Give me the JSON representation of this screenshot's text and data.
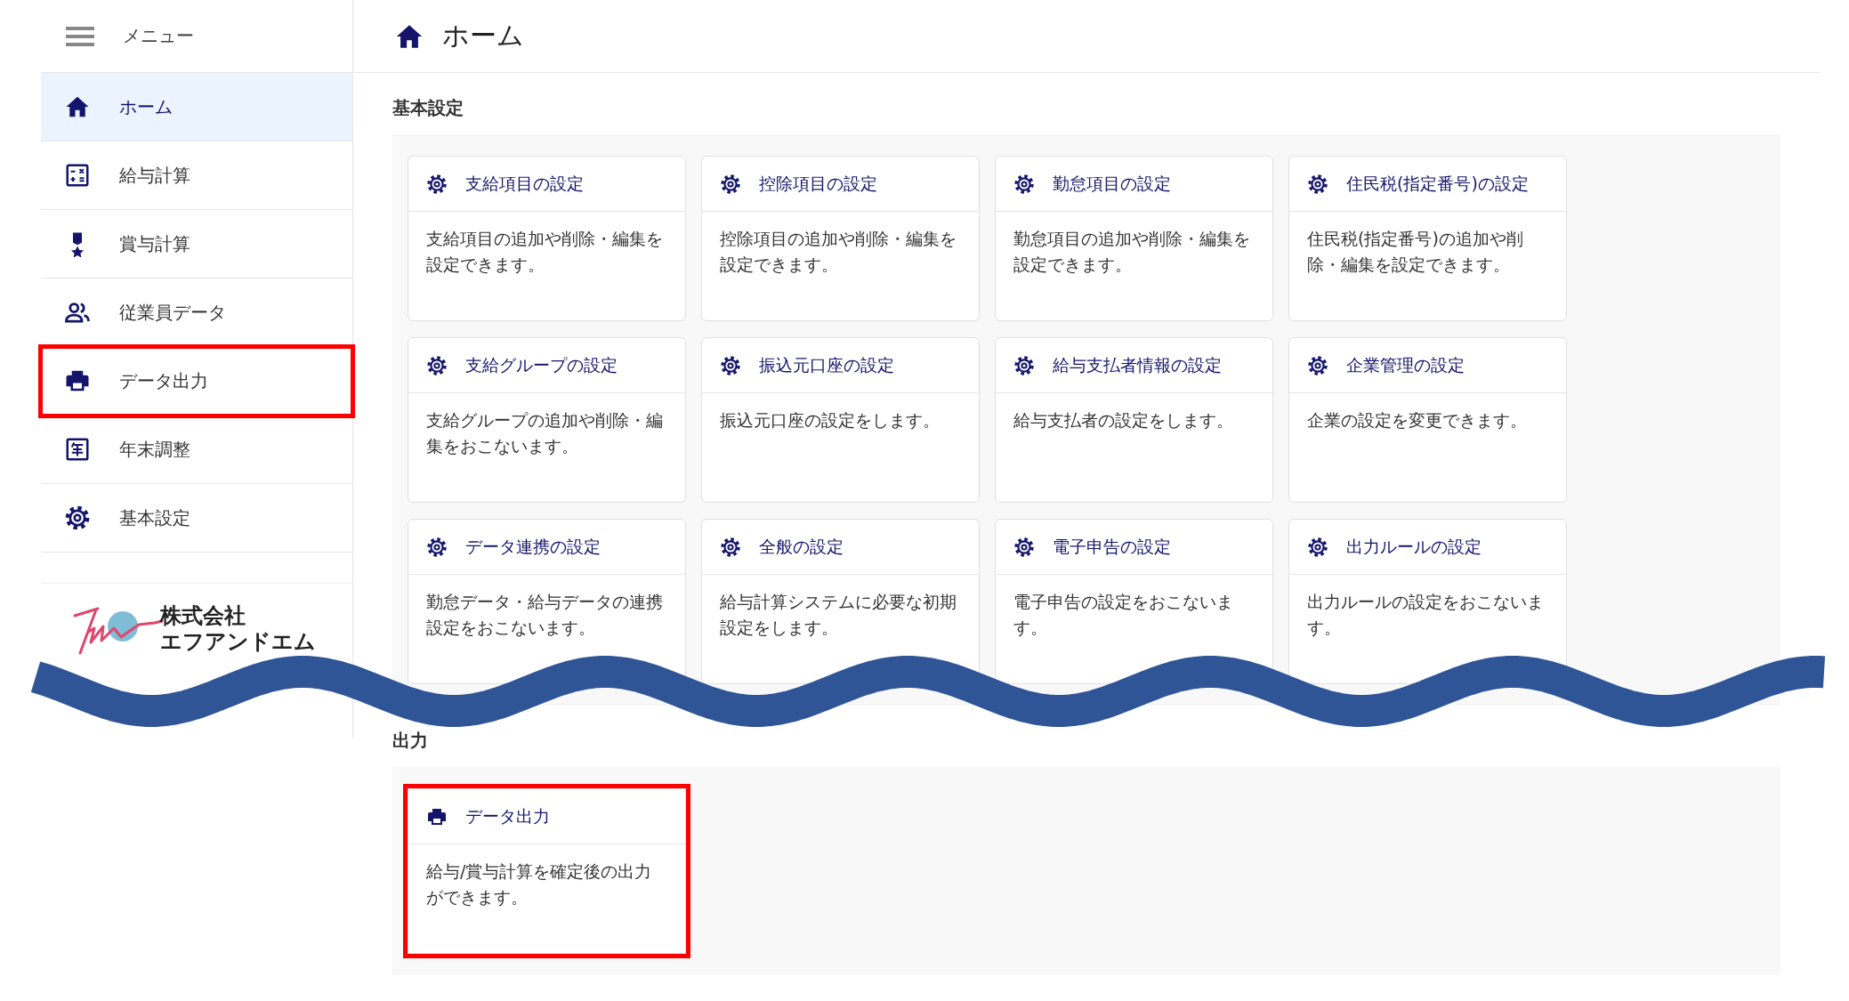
{
  "sidebar": {
    "menu_label": "メニュー",
    "items": [
      {
        "label": "ホーム",
        "kind": "home",
        "selected": true,
        "annotated": false
      },
      {
        "label": "給与計算",
        "kind": "salary",
        "selected": false,
        "annotated": false
      },
      {
        "label": "賞与計算",
        "kind": "bonus",
        "selected": false,
        "annotated": false
      },
      {
        "label": "従業員データ",
        "kind": "employees",
        "selected": false,
        "annotated": false
      },
      {
        "label": "データ出力",
        "kind": "export",
        "selected": false,
        "annotated": true
      },
      {
        "label": "年末調整",
        "kind": "year-end",
        "selected": false,
        "annotated": false
      },
      {
        "label": "基本設定",
        "kind": "settings",
        "selected": false,
        "annotated": false
      }
    ],
    "logo": {
      "line_1": "株式会社",
      "line_2": "エフアンドエム"
    }
  },
  "header": {
    "title": "ホーム"
  },
  "sections": [
    {
      "title": "基本設定",
      "cards": [
        {
          "kind": "settings",
          "title": "支給項目の設定",
          "description": "支給項目の追加や削除・編集を設定できます。",
          "annotated": false
        },
        {
          "kind": "settings",
          "title": "控除項目の設定",
          "description": "控除項目の追加や削除・編集を設定できます。",
          "annotated": false
        },
        {
          "kind": "settings",
          "title": "勤怠項目の設定",
          "description": "勤怠項目の追加や削除・編集を設定できます。",
          "annotated": false
        },
        {
          "kind": "settings",
          "title": "住民税(指定番号)の設定",
          "description": "住民税(指定番号)の追加や削除・編集を設定できます。",
          "annotated": false
        },
        {
          "kind": "settings",
          "title": "支給グループの設定",
          "description": "支給グループの追加や削除・編集をおこないます。",
          "annotated": false
        },
        {
          "kind": "settings",
          "title": "振込元口座の設定",
          "description": "振込元口座の設定をします。",
          "annotated": false
        },
        {
          "kind": "settings",
          "title": "給与支払者情報の設定",
          "description": "給与支払者の設定をします。",
          "annotated": false
        },
        {
          "kind": "settings",
          "title": "企業管理の設定",
          "description": "企業の設定を変更できます。",
          "annotated": false
        },
        {
          "kind": "settings",
          "title": "データ連携の設定",
          "description": "勤怠データ・給与データの連携設定をおこないます。",
          "annotated": false
        },
        {
          "kind": "settings",
          "title": "全般の設定",
          "description": "給与計算システムに必要な初期設定をします。",
          "annotated": false
        },
        {
          "kind": "settings",
          "title": "電子申告の設定",
          "description": "電子申告の設定をおこないます。",
          "annotated": false
        },
        {
          "kind": "settings",
          "title": "出力ルールの設定",
          "description": "出力ルールの設定をおこないます。",
          "annotated": false
        }
      ]
    },
    {
      "title": "出力",
      "cards": [
        {
          "kind": "export",
          "title": "データ出力",
          "description": "給与/賞与計算を確定後の出力ができます。",
          "annotated": true
        }
      ]
    }
  ]
}
